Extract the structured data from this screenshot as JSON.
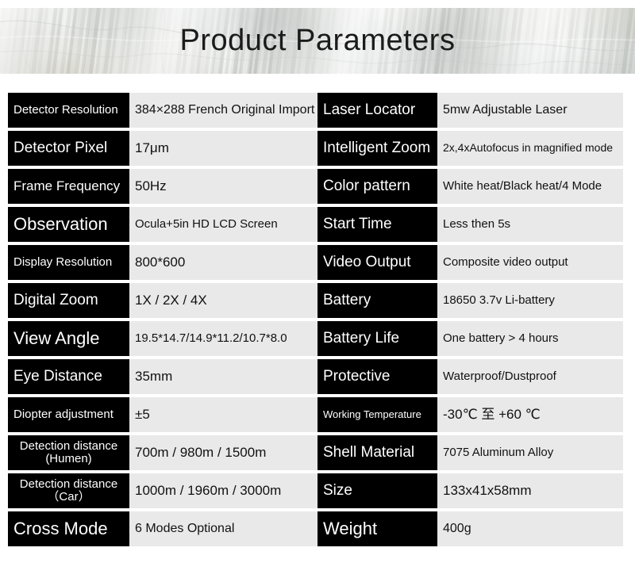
{
  "header": {
    "title": "Product Parameters"
  },
  "colors": {
    "label_bg": "#000000",
    "label_text": "#ffffff",
    "value_bg": "#e9e9e9",
    "value_text": "#111111",
    "page_bg": "#ffffff",
    "header_band": "#d8d9d5"
  },
  "table": {
    "left_column": [
      {
        "label": "Detector Resolution",
        "value": "384×288 French Original Import"
      },
      {
        "label": "Detector Pixel",
        "value": "17μm"
      },
      {
        "label": "Frame Frequency",
        "value": "50Hz"
      },
      {
        "label": "Observation",
        "value": "Ocula+5in HD LCD Screen"
      },
      {
        "label": "Display Resolution",
        "value": "800*600"
      },
      {
        "label": "Digital Zoom",
        "value": "1X / 2X / 4X"
      },
      {
        "label": "View Angle",
        "value": "19.5*14.7/14.9*11.2/10.7*8.0"
      },
      {
        "label": "Eye Distance",
        "value": "35mm"
      },
      {
        "label": "Diopter adjustment",
        "value": "±5"
      },
      {
        "label": "Detection distance\n(Humen)",
        "value": "700m / 980m / 1500m"
      },
      {
        "label": "Detection distance\n（Car）",
        "value": "1000m / 1960m / 3000m"
      },
      {
        "label": "Cross Mode",
        "value": "6 Modes Optional"
      }
    ],
    "right_column": [
      {
        "label": "Laser Locator",
        "value": "5mw Adjustable Laser"
      },
      {
        "label": "Intelligent Zoom",
        "value": "2x,4xAutofocus in magnified mode"
      },
      {
        "label": "Color pattern",
        "value": "White heat/Black heat/4 Mode"
      },
      {
        "label": "Start Time",
        "value": "Less then 5s"
      },
      {
        "label": "Video Output",
        "value": "Composite video output"
      },
      {
        "label": "Battery",
        "value": "18650 3.7v Li-battery"
      },
      {
        "label": "Battery Life",
        "value": "One battery > 4 hours"
      },
      {
        "label": "Protective",
        "value": "Waterproof/Dustproof"
      },
      {
        "label": "Working Temperature",
        "value": "-30℃  至  +60 ℃"
      },
      {
        "label": "Shell Material",
        "value": "7075 Aluminum Alloy"
      },
      {
        "label": "Size",
        "value": "133x41x58mm"
      },
      {
        "label": "Weight",
        "value": "400g"
      }
    ]
  }
}
